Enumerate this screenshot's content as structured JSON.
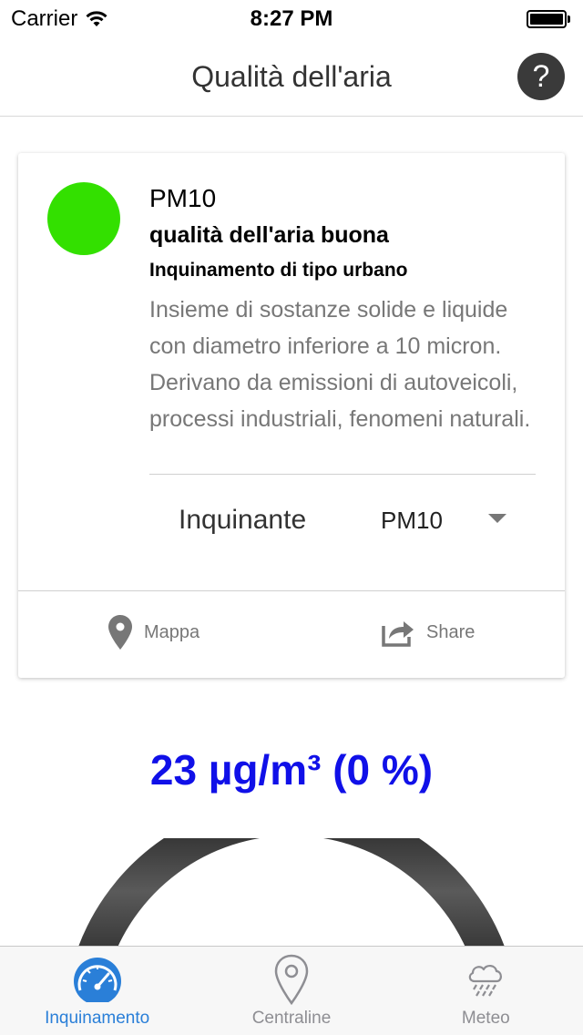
{
  "status_bar": {
    "carrier": "Carrier",
    "time": "8:27 PM"
  },
  "nav": {
    "title": "Qualità dell'aria",
    "help_label": "?"
  },
  "card": {
    "status_color": "#33e000",
    "title": "PM10",
    "quality": "qualità dell'aria buona",
    "type": "Inquinamento di tipo urbano",
    "description": "Insieme di sostanze solide e liquide con diametro inferiore a 10 micron. Derivano da emissioni di autoveicoli, processi industriali, fenomeni naturali.",
    "select": {
      "label": "Inquinante",
      "value": "PM10"
    },
    "actions": {
      "map_label": "Mappa",
      "share_label": "Share"
    }
  },
  "reading": {
    "text": "23 µg/m³ (0 %)",
    "color": "#1010e8"
  },
  "tabs": [
    {
      "label": "Inquinamento",
      "icon": "speedometer-icon",
      "active": true
    },
    {
      "label": "Centraline",
      "icon": "map-pin-icon",
      "active": false
    },
    {
      "label": "Meteo",
      "icon": "rain-cloud-icon",
      "active": false
    }
  ],
  "colors": {
    "accent": "#2a7fd8",
    "good": "#33e000"
  }
}
